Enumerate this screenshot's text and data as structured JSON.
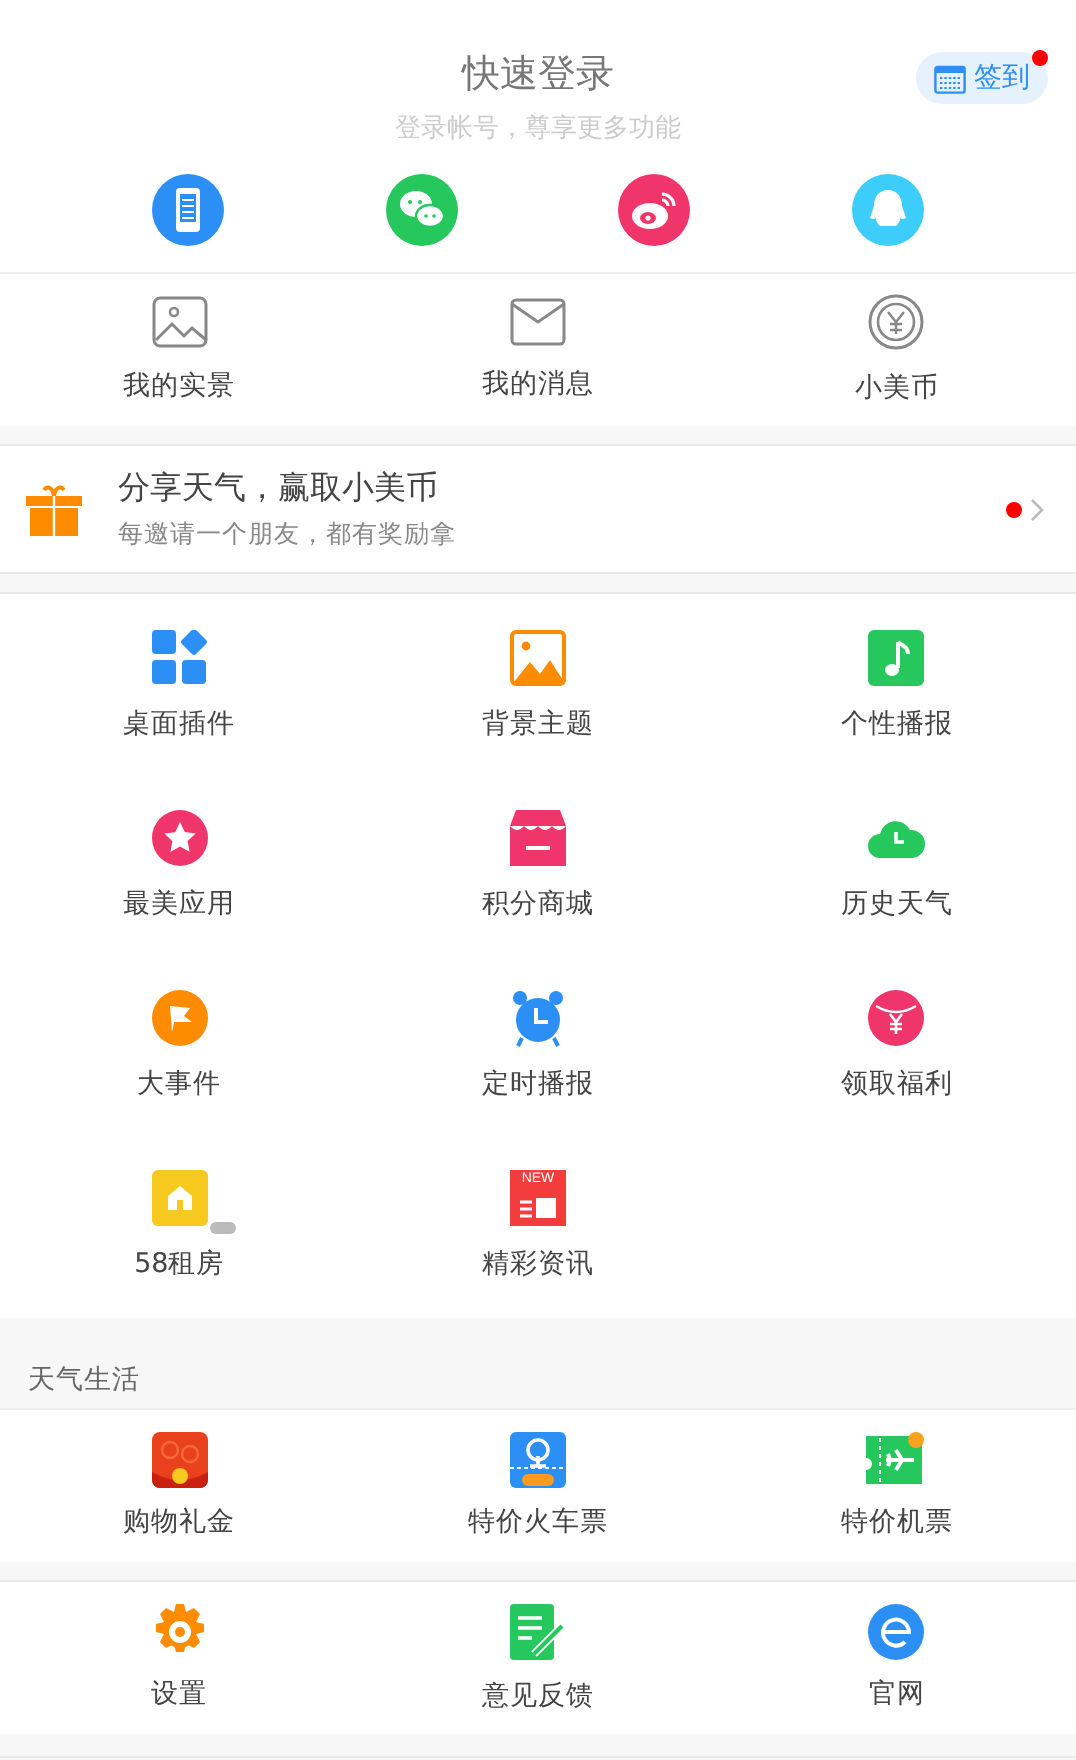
{
  "header": {
    "title": "快速登录",
    "subtitle": "登录帐号，尊享更多功能",
    "checkin": {
      "label": "签到",
      "has_notice": true
    }
  },
  "account_links": [
    {
      "label": "我的实景"
    },
    {
      "label": "我的消息"
    },
    {
      "label": "小美币"
    }
  ],
  "promo": {
    "title": "分享天气，赢取小美币",
    "subtitle": "每邀请一个朋友，都有奖励拿",
    "has_notice": true
  },
  "features": [
    {
      "label": "桌面插件"
    },
    {
      "label": "背景主题"
    },
    {
      "label": "个性播报"
    },
    {
      "label": "最美应用"
    },
    {
      "label": "积分商城"
    },
    {
      "label": "历史天气"
    },
    {
      "label": "大事件"
    },
    {
      "label": "定时播报"
    },
    {
      "label": "领取福利"
    },
    {
      "label": "58租房",
      "ad": true
    },
    {
      "label": "精彩资讯",
      "kind": "news"
    }
  ],
  "news_icon_label": "NEW",
  "life": {
    "title": "天气生活",
    "items": [
      {
        "label": "购物礼金"
      },
      {
        "label": "特价火车票"
      },
      {
        "label": "特价机票"
      }
    ]
  },
  "settings": [
    {
      "label": "设置"
    },
    {
      "label": "意见反馈"
    },
    {
      "label": "官网"
    }
  ]
}
